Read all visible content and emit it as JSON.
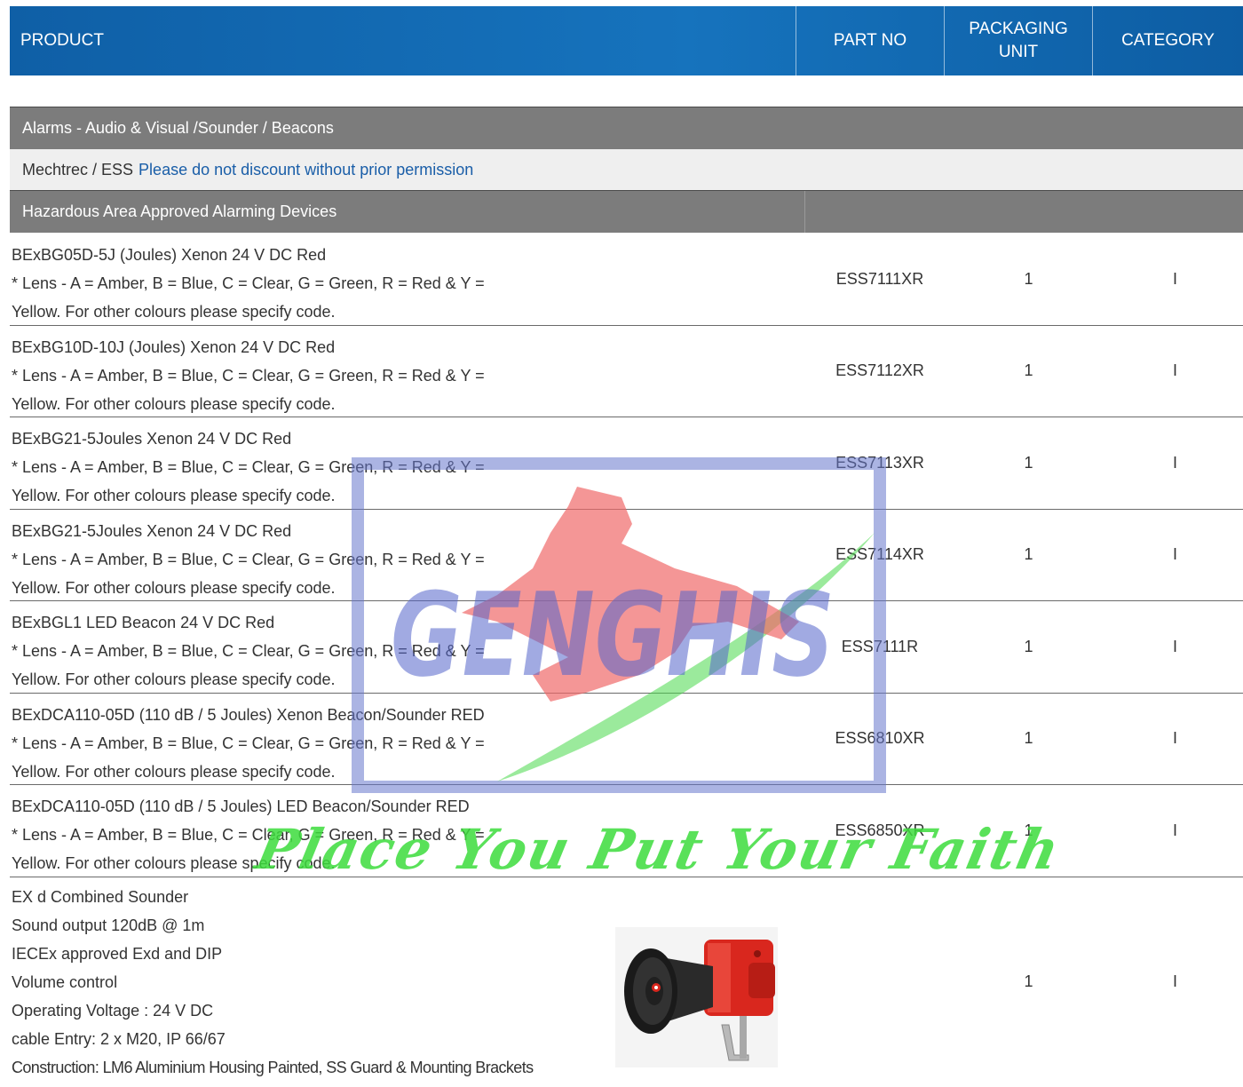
{
  "header": {
    "product": "PRODUCT",
    "part_no": "PART NO",
    "packaging_line1": "PACKAGING",
    "packaging_line2": "UNIT",
    "category": "CATEGORY"
  },
  "section": {
    "title": "Alarms - Audio & Visual /Sounder / Beacons",
    "brand": "Mechtrec / ESS",
    "note": "Please do not discount without prior permission",
    "subsection": "Hazardous Area Approved Alarming Devices"
  },
  "rows": [
    {
      "line1": "BExBG05D-5J (Joules) Xenon 24 V DC Red",
      "line2": "* Lens - A = Amber, B = Blue, C = Clear, G = Green, R = Red & Y =",
      "line3": "Yellow. For other colours please specify code.",
      "part_no": "ESS7111XR",
      "pack": "1",
      "category": "I"
    },
    {
      "line1": "BExBG10D-10J (Joules) Xenon 24 V DC Red",
      "line2": "* Lens - A = Amber, B = Blue, C = Clear, G = Green, R = Red & Y =",
      "line3": "Yellow. For other colours please specify code.",
      "part_no": "ESS7112XR",
      "pack": "1",
      "category": "I"
    },
    {
      "line1": "BExBG21-5Joules Xenon 24 V DC Red",
      "line2": "* Lens - A = Amber, B = Blue, C = Clear, G = Green, R = Red & Y =",
      "line3": "Yellow. For other colours please specify code.",
      "part_no": "ESS7113XR",
      "pack": "1",
      "category": "I"
    },
    {
      "line1": "BExBG21-5Joules Xenon 24 V DC Red",
      "line2": "* Lens - A = Amber, B = Blue, C = Clear, G = Green, R = Red & Y =",
      "line3": "Yellow. For other colours please specify code.",
      "part_no": "ESS7114XR",
      "pack": "1",
      "category": "I"
    },
    {
      "line1": "BExBGL1 LED Beacon 24 V DC Red",
      "line2": "* Lens - A = Amber, B = Blue, C = Clear, G = Green, R = Red & Y =",
      "line3": "Yellow. For other colours please specify code.",
      "part_no": "ESS7111R",
      "pack": "1",
      "category": "I"
    },
    {
      "line1": "BExDCA110-05D (110 dB / 5 Joules) Xenon Beacon/Sounder RED",
      "line2": "* Lens - A = Amber, B = Blue, C = Clear, G = Green, R = Red & Y =",
      "line3": "Yellow. For other colours please specify code.",
      "part_no": "ESS6810XR",
      "pack": "1",
      "category": "I"
    },
    {
      "line1": "BExDCA110-05D (110 dB / 5 Joules) LED Beacon/Sounder RED",
      "line2": "* Lens - A = Amber, B = Blue, C = Clear, G = Green, R = Red & Y =",
      "line3": "Yellow. For other colours please specify code.",
      "part_no": "ESS6850XR",
      "pack": "1",
      "category": "I"
    }
  ],
  "last_row": {
    "lines": [
      "EX d Combined Sounder",
      "Sound output 120dB @ 1m",
      "IECEx approved Exd and DIP",
      "Volume control",
      "Operating Voltage : 24 V DC",
      "cable Entry: 2 x M20, IP 66/67",
      "Construction: LM6 Aluminium Housing Painted, SS Guard & Mounting Brackets"
    ],
    "pack": "1",
    "category": "I",
    "image_icon": "horn-sounder-icon"
  },
  "watermark": {
    "brand": "GENGHIS",
    "tagline": "Place You Put Your Faith",
    "icon": "horse-logo-icon"
  },
  "colors": {
    "header_blue": "#1673bd",
    "section_grey": "#7c7c7c",
    "note_blue": "#1a5ea8",
    "watermark_green": "#3ddc3d",
    "watermark_blue": "#5566cc",
    "watermark_red": "#f06a6a"
  }
}
